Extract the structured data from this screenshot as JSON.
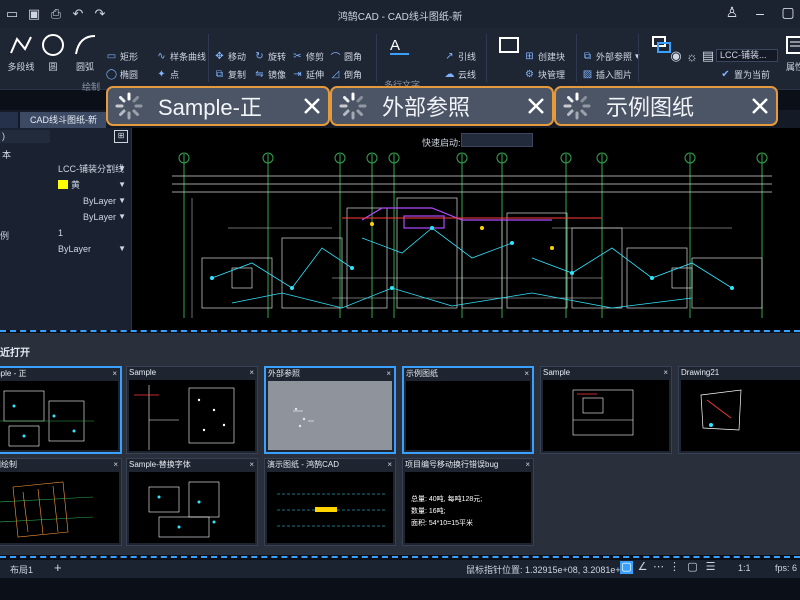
{
  "titlebar": {
    "title": "鸿鹄CAD - CAD线斗图纸-新"
  },
  "ribbon": {
    "big_buttons": [
      "多段线",
      "圆",
      "圆弧"
    ],
    "draw_items": [
      "矩形",
      "椭圆",
      "样条曲线",
      "点"
    ],
    "modify_items": [
      "移动",
      "复制",
      "旋转",
      "镜像",
      "修剪",
      "延伸",
      "圆角",
      "倒角"
    ],
    "group_draw": "绘制",
    "annotation_items": [
      "引线",
      "云线"
    ],
    "text_label": "多行文字",
    "block_items": [
      "创建块",
      "块管理"
    ],
    "insert_items": [
      "外部参照",
      "插入图片"
    ],
    "layer_value": "LCC-铺装...",
    "layer_items": [
      "置为当前"
    ],
    "properties_label": "属性"
  },
  "tabs": {
    "active_doc": "CAD线斗图纸-新",
    "floating": [
      "Sample-正",
      "外部参照",
      "示例图纸"
    ]
  },
  "properties": {
    "header": ")",
    "section": "本",
    "rows": [
      {
        "key": "",
        "value": "LCC-铺装分割线"
      },
      {
        "key": "",
        "value": "黄"
      },
      {
        "key": "",
        "value": "ByLayer"
      },
      {
        "key": "",
        "value": "ByLayer"
      },
      {
        "key": "例",
        "value": "1"
      },
      {
        "key": "",
        "value": "ByLayer"
      }
    ]
  },
  "drawing": {
    "quick_start_label": "快速启动:",
    "grid_numbers": [
      "1",
      "2",
      "3",
      "4",
      "5",
      "6",
      "7",
      "8",
      "9",
      "10",
      "11",
      "12",
      "13",
      "14",
      "15"
    ],
    "top_dimension": "43400"
  },
  "recent": {
    "title": "近打开",
    "files": [
      {
        "name": "mple - 正"
      },
      {
        "name": "Sample"
      },
      {
        "name": "外部参照"
      },
      {
        "name": "示例图纸"
      },
      {
        "name": "Sample"
      },
      {
        "name": "Drawing21"
      },
      {
        "name": "图绘制"
      },
      {
        "name": "Sample-替换字体"
      },
      {
        "name": "演示图纸 - 鸿鹄CAD"
      },
      {
        "name": "项目编号移动换行错误bug"
      }
    ],
    "text_preview": [
      "总量: 40吨, 每吨128元;",
      "数量: 16吨;",
      "面积: 54*10=15平米"
    ]
  },
  "statusbar": {
    "layout_tab": "布局1",
    "add_label": "+",
    "coords": "鼠标指针位置: 1.32915e+08, 3.2081e+07",
    "scale": "1:1",
    "fps": "fps: 6"
  },
  "colors": {
    "accent": "#3aa0ff",
    "tab_border": "#e49a3d",
    "panel": "#1a2130",
    "drawing_bg": "#000000"
  }
}
